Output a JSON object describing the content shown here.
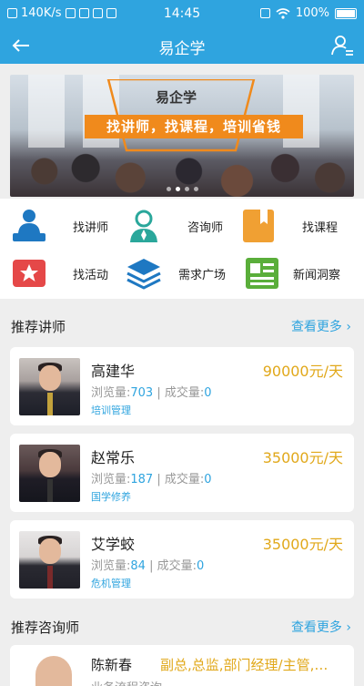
{
  "status_bar": {
    "network_speed": "140K/s",
    "time": "14:45",
    "battery": "100%"
  },
  "nav": {
    "title": "易企学",
    "back_icon": "arrow-left-icon",
    "user_menu_icon": "user-list-icon"
  },
  "banner": {
    "brand": "易企学",
    "slogan": "找讲师，找课程，培训省钱",
    "active_slide": 1,
    "slide_count": 4
  },
  "quick_menu": [
    {
      "label": "找讲师",
      "icon": "lecturer-icon",
      "color": "#1e78c2"
    },
    {
      "label": "咨询师",
      "icon": "consultant-icon",
      "color": "#2aa79b"
    },
    {
      "label": "找课程",
      "icon": "bookmark-icon",
      "color": "#f0a033"
    },
    {
      "label": "找活动",
      "icon": "star-flag-icon",
      "color": "#e54848"
    },
    {
      "label": "需求广场",
      "icon": "layers-icon",
      "color": "#1e78c2"
    },
    {
      "label": "新闻洞察",
      "icon": "news-icon",
      "color": "#5aae3a"
    }
  ],
  "section_lecturers": {
    "title": "推荐讲师",
    "more": "查看更多"
  },
  "lecturers": [
    {
      "name": "高建华",
      "price": "90000元/天",
      "views_label": "浏览量:",
      "views": "703",
      "deals_label": "成交量:",
      "deals": "0",
      "tag": "培训管理"
    },
    {
      "name": "赵常乐",
      "price": "35000元/天",
      "views_label": "浏览量:",
      "views": "187",
      "deals_label": "成交量:",
      "deals": "0",
      "tag": "国学修养"
    },
    {
      "name": "艾学蛟",
      "price": "35000元/天",
      "views_label": "浏览量:",
      "views": "84",
      "deals_label": "成交量:",
      "deals": "0",
      "tag": "危机管理"
    }
  ],
  "section_consultants": {
    "title": "推荐咨询师",
    "more": "查看更多"
  },
  "consultants": [
    {
      "name": "陈新春",
      "price": "副总,总监,部门经理/主管,…",
      "sub": "业务流程咨询"
    }
  ],
  "colors": {
    "primary": "#2fa4df",
    "price": "#e1a81a"
  }
}
